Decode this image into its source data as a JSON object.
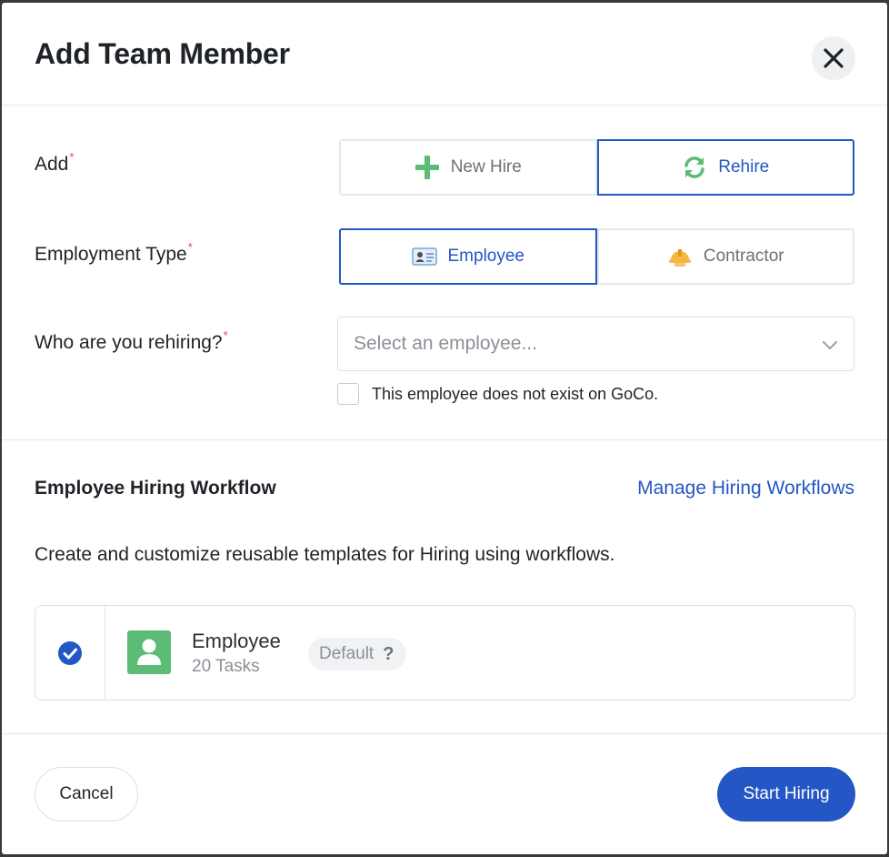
{
  "modal": {
    "title": "Add Team Member"
  },
  "add": {
    "label": "Add",
    "required_mark": "*",
    "options": [
      {
        "label": "New Hire",
        "icon": "plus-icon",
        "active": false
      },
      {
        "label": "Rehire",
        "icon": "refresh-icon",
        "active": true
      }
    ]
  },
  "employment_type": {
    "label": "Employment Type",
    "required_mark": "*",
    "options": [
      {
        "label": "Employee",
        "icon": "id-card-icon",
        "active": true
      },
      {
        "label": "Contractor",
        "icon": "hard-hat-icon",
        "active": false
      }
    ]
  },
  "rehiring": {
    "label": "Who are you rehiring?",
    "required_mark": "*",
    "placeholder": "Select an employee...",
    "checkbox_label": "This employee does not exist on GoCo.",
    "checkbox_checked": false
  },
  "workflow": {
    "title": "Employee Hiring Workflow",
    "manage_link": "Manage Hiring Workflows",
    "description": "Create and customize reusable templates for Hiring using workflows.",
    "item": {
      "name": "Employee",
      "tasks": "20 Tasks",
      "badge": "Default",
      "help": "?",
      "selected": true
    }
  },
  "footer": {
    "cancel_label": "Cancel",
    "start_label": "Start Hiring"
  },
  "colors": {
    "primary": "#2457c5",
    "green": "#5cbb75",
    "required": "#e5484d"
  }
}
